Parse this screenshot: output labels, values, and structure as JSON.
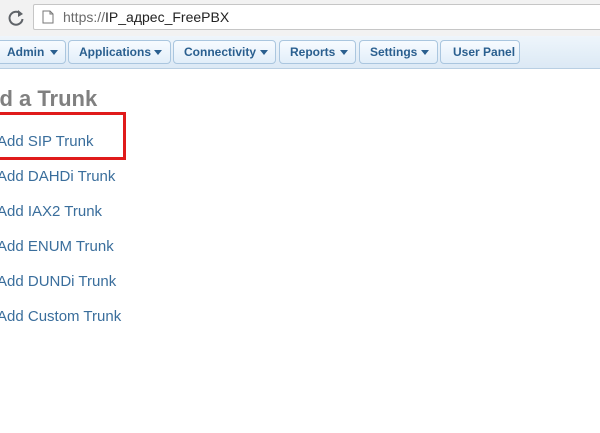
{
  "browser": {
    "url_scheme": "https://",
    "url_host": "IP_адрес_FreePBX",
    "reload_icon": "reload-icon",
    "page_icon": "page-icon"
  },
  "nav": {
    "items": [
      {
        "label": "Admin",
        "has_dropdown": true
      },
      {
        "label": "Applications",
        "has_dropdown": true
      },
      {
        "label": "Connectivity",
        "has_dropdown": true
      },
      {
        "label": "Reports",
        "has_dropdown": true
      },
      {
        "label": "Settings",
        "has_dropdown": true
      },
      {
        "label": "User Panel",
        "has_dropdown": false
      }
    ]
  },
  "main": {
    "title": "dd a Trunk",
    "links": [
      "Add SIP Trunk",
      "Add DAHDi Trunk",
      "Add IAX2 Trunk",
      "Add ENUM Trunk",
      "Add DUNDi Trunk",
      "Add Custom Trunk"
    ],
    "highlighted_link": "Add SIP Trunk"
  },
  "colors": {
    "link": "#3a6e9c",
    "nav_text": "#2a5f8f",
    "title": "#808080",
    "highlight": "#e01b1b"
  }
}
